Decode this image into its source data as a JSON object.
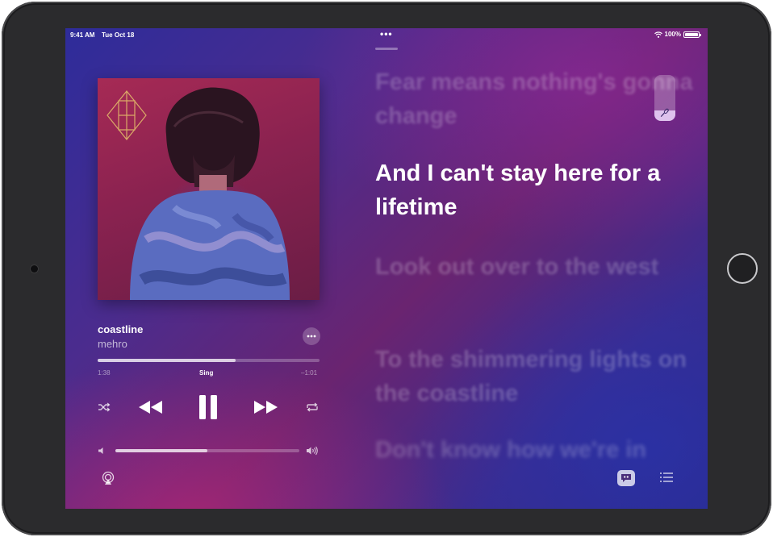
{
  "status_bar": {
    "time": "9:41 AM",
    "date": "Tue Oct 18",
    "center_dots": "•••",
    "battery_percent": "100%",
    "wifi_icon": "wifi-icon",
    "battery_icon": "battery-icon"
  },
  "now_playing": {
    "title": "coastline",
    "artist": "mehro",
    "album_art": "album-cover-image",
    "more_icon": "ellipsis-icon",
    "progress": {
      "elapsed": "1:38",
      "remaining": "–1:01",
      "fraction": 0.62,
      "sing_label": "Sing"
    },
    "controls": {
      "shuffle_icon": "shuffle-icon",
      "rewind_icon": "rewind-icon",
      "playpause_icon": "pause-icon",
      "forward_icon": "fast-forward-icon",
      "repeat_icon": "repeat-icon"
    },
    "volume": {
      "fraction": 0.5,
      "low_icon": "speaker-low-icon",
      "high_icon": "speaker-high-icon"
    },
    "bottom": {
      "airplay_icon": "airplay-icon",
      "lyrics_icon": "lyrics-quote-icon",
      "queue_icon": "queue-list-icon"
    }
  },
  "lyrics": {
    "lines": [
      "Fear means nothing's gonna change",
      "And I can't stay here for a lifetime",
      "Look out over to the west",
      "To the shimmering lights on the coastline",
      "Don't know how we're in"
    ],
    "active_index": 1,
    "vocal_level": 0.22,
    "vocal_icon": "microphone-icon"
  },
  "colors": {
    "accent": "#ffffff",
    "background_top": "#2e2c9a",
    "background_mid": "#6a2470"
  }
}
